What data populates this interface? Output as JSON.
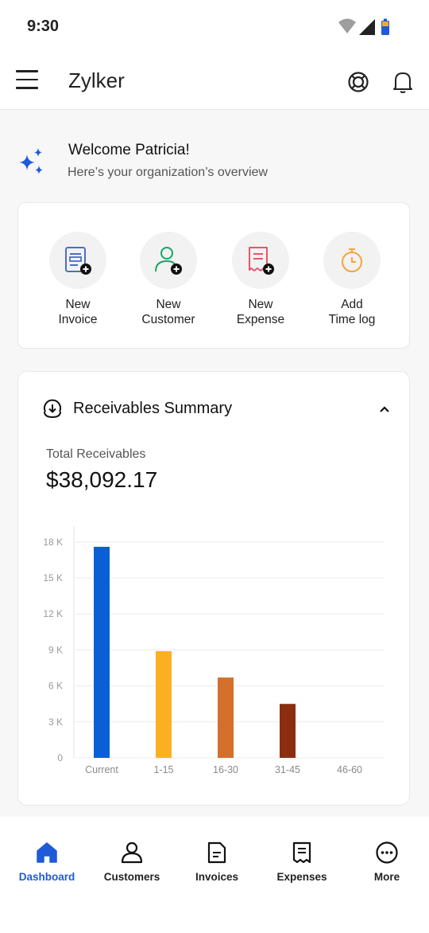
{
  "status_bar": {
    "time": "9:30"
  },
  "app_bar": {
    "title": "Zylker"
  },
  "welcome": {
    "title": "Welcome Patricia!",
    "subtitle": "Here’s your organization’s overview"
  },
  "quick_actions": [
    {
      "line1": "New",
      "line2": "Invoice",
      "icon": "invoice-icon"
    },
    {
      "line1": "New",
      "line2": "Customer",
      "icon": "customer-icon"
    },
    {
      "line1": "New",
      "line2": "Expense",
      "icon": "expense-icon"
    },
    {
      "line1": "Add",
      "line2": "Time log",
      "icon": "timer-icon"
    }
  ],
  "receivables": {
    "title": "Receivables Summary",
    "total_label": "Total Receivables",
    "total_value": "$38,092.17"
  },
  "chart_data": {
    "type": "bar",
    "categories": [
      "Current",
      "1-15",
      "16-30",
      "31-45",
      "46-60"
    ],
    "values": [
      17600,
      8900,
      6700,
      4500,
      0
    ],
    "colors": [
      "#0a5fd6",
      "#fbb021",
      "#d4702b",
      "#8b2e10",
      "#cccccc"
    ],
    "yticks": [
      0,
      3000,
      6000,
      9000,
      12000,
      15000,
      18000
    ],
    "ytick_labels": [
      "0",
      "3 K",
      "6 K",
      "9 K",
      "12 K",
      "15 K",
      "18 K"
    ],
    "ylim": [
      0,
      18000
    ]
  },
  "bottom_nav": [
    {
      "label": "Dashboard",
      "icon": "home-icon",
      "active": true
    },
    {
      "label": "Customers",
      "icon": "customers-icon",
      "active": false
    },
    {
      "label": "Invoices",
      "icon": "invoices-icon",
      "active": false
    },
    {
      "label": "Expenses",
      "icon": "expenses-icon",
      "active": false
    },
    {
      "label": "More",
      "icon": "more-icon",
      "active": false
    }
  ],
  "colors": {
    "accent": "#1f5bd6",
    "customer_green": "#1aa36b",
    "expense_red": "#e4586a",
    "timer_orange": "#f3a53a",
    "invoice_blue": "#4a6fc4"
  }
}
